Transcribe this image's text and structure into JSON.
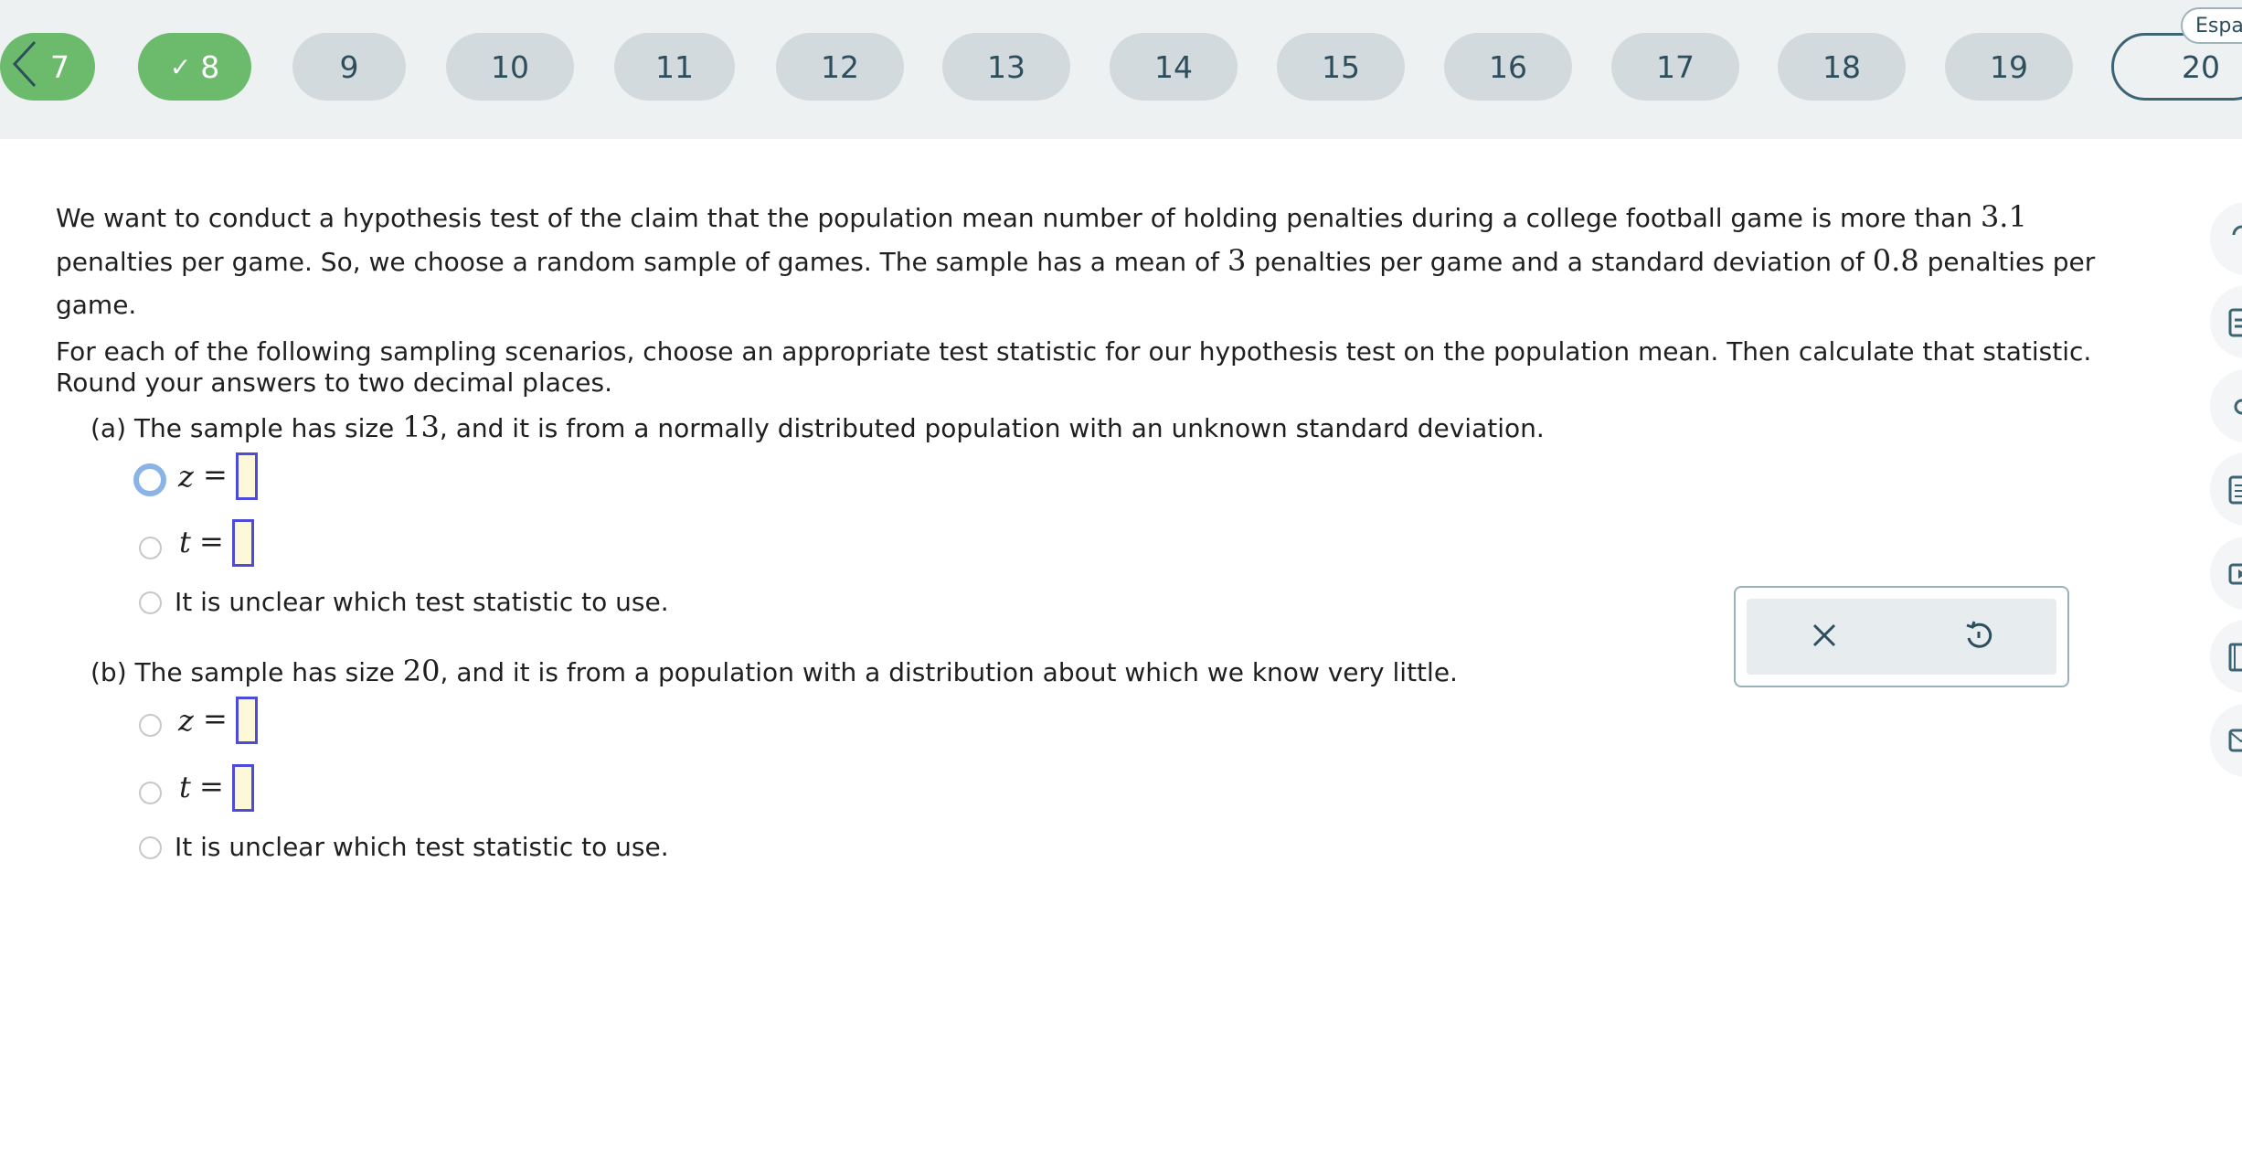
{
  "nav": {
    "back_icon": "chevron-left-icon",
    "items": [
      {
        "label": "7",
        "status": "done"
      },
      {
        "label": "8",
        "status": "done"
      },
      {
        "label": "9",
        "status": "unanswered"
      },
      {
        "label": "10",
        "status": "unanswered"
      },
      {
        "label": "11",
        "status": "unanswered"
      },
      {
        "label": "12",
        "status": "unanswered"
      },
      {
        "label": "13",
        "status": "unanswered"
      },
      {
        "label": "14",
        "status": "unanswered"
      },
      {
        "label": "15",
        "status": "unanswered"
      },
      {
        "label": "16",
        "status": "unanswered"
      },
      {
        "label": "17",
        "status": "unanswered"
      },
      {
        "label": "18",
        "status": "unanswered"
      },
      {
        "label": "19",
        "status": "unanswered"
      },
      {
        "label": "20",
        "status": "current"
      }
    ],
    "done_icon": "check-icon",
    "language_button": "Espa"
  },
  "question": {
    "intro_1a": "We want to conduct a hypothesis test of the claim that the population mean number of holding penalties during a college football game is more than ",
    "claim_mean": "3.1",
    "intro_1b": "penalties per game. So, we choose a random sample of games. The sample has a mean of ",
    "sample_mean": "3",
    "intro_1c": " penalties per game and a standard deviation of ",
    "sample_sd": "0.8",
    "intro_1d": " penalties per game.",
    "instructions": "For each of the following sampling scenarios, choose an appropriate test statistic for our hypothesis test on the population mean. Then calculate that statistic. Round your answers to two decimal places.",
    "parts": [
      {
        "label": "(a)",
        "text_before": "The sample has size ",
        "size": "13",
        "text_after": ", and it is from a normally distributed population with an unknown standard deviation.",
        "z_var": "z",
        "t_var": "t",
        "equals": "=",
        "z_value": "",
        "t_value": "",
        "unclear": "It is unclear which test statistic to use."
      },
      {
        "label": "(b)",
        "text_before": "The sample has size ",
        "size": "20",
        "text_after": ", and it is from a population with a distribution about which we know very little.",
        "z_var": "z",
        "t_var": "t",
        "equals": "=",
        "z_value": "",
        "t_value": "",
        "unclear": "It is unclear which test statistic to use."
      }
    ]
  },
  "tools": {
    "clear_icon": "close-icon",
    "undo_icon": "undo-icon"
  },
  "rail": {
    "icons": [
      "help-icon",
      "calculator-icon",
      "reading-icon",
      "list-icon",
      "video-icon",
      "book-icon",
      "message-icon"
    ]
  },
  "colors": {
    "done": "#6cbb6c",
    "pill": "#d3dade",
    "pill_text": "#2d4e5c",
    "current_border": "#3d6474",
    "answer_box_fill": "#fdf8d8",
    "answer_box_border": "#4c4cd8",
    "focus_ring": "#8ab4e6"
  }
}
